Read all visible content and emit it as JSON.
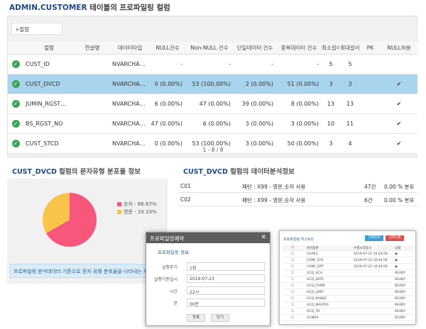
{
  "title": {
    "table": "ADMIN.CUSTOMER",
    "suffix": "테이블의 프로파일링 컬럼"
  },
  "filter": {
    "placeholder": "+컬럼"
  },
  "grid": {
    "headers": [
      "",
      "컬럼",
      "한글명",
      "데이터타입",
      "NULL건수",
      "Non-NULL 건수",
      "단일데이터 건수",
      "중복데이터 건수",
      "최소길이",
      "최대길이",
      "PK",
      "NULL허용"
    ],
    "rows": [
      {
        "name": "CUST_ID",
        "type": "NVARCHA…",
        "null": "-",
        "nonnull": "-",
        "single": "-",
        "dup": "-",
        "min": "5",
        "max": "5",
        "pk": "",
        "nullable": "",
        "selected": false
      },
      {
        "name": "CUST_DVCD",
        "type": "NVARCHA…",
        "null": "0 (0.00%)",
        "nonnull": "53 (100.00%)",
        "single": "2 (0.00%)",
        "dup": "51 (0.00%)",
        "min": "3",
        "max": "3",
        "pk": "",
        "nullable": "✔",
        "selected": true
      },
      {
        "name": "JUMIN_RGST…",
        "type": "NVARCHA…",
        "null": "6 (0.00%)",
        "nonnull": "47 (0.00%)",
        "single": "39 (0.00%)",
        "dup": "8 (0.00%)",
        "min": "13",
        "max": "13",
        "pk": "",
        "nullable": "✔",
        "selected": false
      },
      {
        "name": "BS_RGST_NO",
        "type": "NVARCHA…",
        "null": "47 (0.00%)",
        "nonnull": "6 (0.00%)",
        "single": "3 (0.00%)",
        "dup": "3 (0.00%)",
        "min": "10",
        "max": "11",
        "pk": "",
        "nullable": "✔",
        "selected": false
      },
      {
        "name": "CUST_STCD",
        "type": "NVARCHA…",
        "null": "0 (0.00%)",
        "nonnull": "53 (100.00%)",
        "single": "3 (0.00%)",
        "dup": "50 (0.00%)",
        "min": "3",
        "max": "4",
        "pk": "",
        "nullable": "✔",
        "selected": false
      }
    ],
    "pager": "1 - 8 / 8"
  },
  "pie_section": {
    "column": "CUST_DVCD",
    "label": "컬럼의 문자유형 분포율 정보"
  },
  "chart_data": {
    "type": "pie",
    "categories": [
      "숫자",
      "영문"
    ],
    "values": [
      66.67,
      33.33
    ],
    "legend": [
      "숫자 - 66.67%",
      "영문 - 33.33%"
    ],
    "colors": [
      "#f6577b",
      "#f8c44a"
    ],
    "legend_position": "right"
  },
  "pie_note": "프로파일링 분석데이터 기준으로 문자 유형 분포율을 나타내는 차트",
  "analysis_section": {
    "column": "CUST_DVCD",
    "label": "컬럼의 데이터분석정보",
    "rows": [
      {
        "code": "C01",
        "pattern": "패턴 : X99 - 영문,숫자 사용",
        "count": "47건",
        "pct": "0.00 % 분포"
      },
      {
        "code": "C02",
        "pattern": "패턴 : X99 - 영문,숫자 사용",
        "count": "6건",
        "pct": "0.00 % 분포"
      }
    ]
  },
  "schedule_dialog": {
    "title": "프로파일링예약",
    "subtitle": "프로파일링 정보",
    "fields": [
      {
        "label": "실행주기",
        "value": "1회"
      },
      {
        "label": "실행기준일시",
        "value": "2019-07-23"
      },
      {
        "label": "시간",
        "value": "22시"
      },
      {
        "label": "분",
        "value": "00분"
      }
    ],
    "buttons": [
      "등록",
      "닫기"
    ]
  },
  "list_dialog": {
    "title": "프로파일링 히스토리",
    "buttons": [
      "전체조회",
      "선택삭제"
    ],
    "headers": [
      "테이블명",
      "수행시작일시",
      "상태"
    ],
    "rows": [
      {
        "name": "CHAR1",
        "date": "2019-07-22 16:44:59",
        "state": "◉"
      },
      {
        "name": "CONF_SYS",
        "date": "2019-07-22 16:44:59",
        "state": "◉"
      },
      {
        "name": "CONF_OPT",
        "date": "2019-07-22 16:44:59",
        "state": "◉"
      },
      {
        "name": "GCQ_SCH",
        "date": "",
        "state": "READY"
      },
      {
        "name": "GCQ_DATE",
        "date": "",
        "state": "READY"
      },
      {
        "name": "GCQ_FORM",
        "date": "",
        "state": "READY"
      },
      {
        "name": "GCQ_LIMIT",
        "date": "",
        "state": "READY"
      },
      {
        "name": "GCQ_RANGE",
        "date": "",
        "state": "READY"
      },
      {
        "name": "GCQ_MASTER",
        "date": "",
        "state": "READY"
      },
      {
        "name": "GCQ_TB",
        "date": "",
        "state": "READY"
      },
      {
        "name": "GCNDX",
        "date": "",
        "state": "READY"
      }
    ]
  }
}
